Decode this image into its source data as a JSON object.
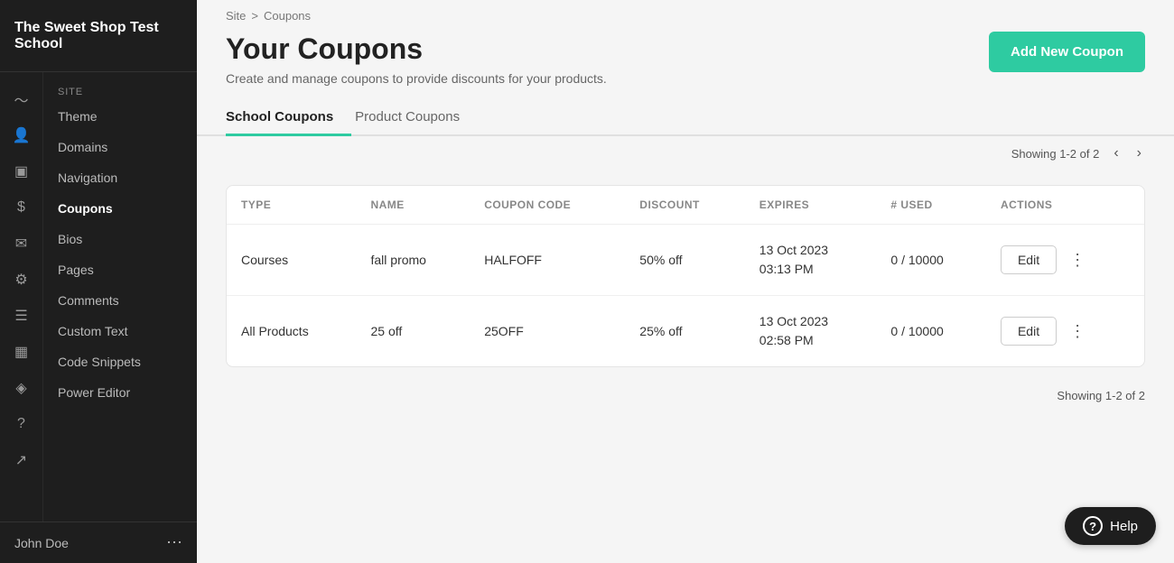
{
  "sidebar": {
    "school_name": "The Sweet Shop Test School",
    "site_section_label": "SITE",
    "nav_items": [
      {
        "id": "theme",
        "label": "Theme",
        "icon": "◨"
      },
      {
        "id": "domains",
        "label": "Domains",
        "icon": "⊕"
      },
      {
        "id": "navigation",
        "label": "Navigation",
        "icon": "☰"
      },
      {
        "id": "coupons",
        "label": "Coupons",
        "icon": "✂",
        "active": true
      },
      {
        "id": "bios",
        "label": "Bios",
        "icon": "⚙"
      },
      {
        "id": "pages",
        "label": "Pages",
        "icon": "☰"
      },
      {
        "id": "comments",
        "label": "Comments",
        "icon": "✉"
      },
      {
        "id": "custom-text",
        "label": "Custom Text",
        "icon": "T"
      },
      {
        "id": "code-snippets",
        "label": "Code Snippets",
        "icon": "</>"
      },
      {
        "id": "power-editor",
        "label": "Power Editor",
        "icon": "⚡"
      }
    ],
    "footer": {
      "user_name": "John Doe"
    }
  },
  "breadcrumb": {
    "site": "Site",
    "separator": ">",
    "current": "Coupons"
  },
  "page": {
    "title": "Your Coupons",
    "subtitle": "Create and manage coupons to provide discounts for your products.",
    "add_button": "Add New Coupon"
  },
  "tabs": [
    {
      "id": "school-coupons",
      "label": "School Coupons",
      "active": true
    },
    {
      "id": "product-coupons",
      "label": "Product Coupons",
      "active": false
    }
  ],
  "pagination": {
    "showing": "Showing 1-2 of 2",
    "showing_bottom": "Showing 1-2 of 2"
  },
  "table": {
    "columns": [
      "TYPE",
      "NAME",
      "COUPON CODE",
      "DISCOUNT",
      "EXPIRES",
      "# USED",
      "ACTIONS"
    ],
    "rows": [
      {
        "type": "Courses",
        "name": "fall promo",
        "coupon_code": "HALFOFF",
        "discount": "50% off",
        "expires_line1": "13 Oct 2023",
        "expires_line2": "03:13 PM",
        "used": "0 / 10000",
        "edit_label": "Edit"
      },
      {
        "type": "All Products",
        "name": "25 off",
        "coupon_code": "25OFF",
        "discount": "25% off",
        "expires_line1": "13 Oct 2023",
        "expires_line2": "02:58 PM",
        "used": "0 / 10000",
        "edit_label": "Edit"
      }
    ]
  },
  "help": {
    "label": "Help"
  },
  "icons": {
    "analytics": "📊",
    "users": "👤",
    "dashboard": "▣",
    "dollar": "💲",
    "mail": "✉",
    "settings": "⚙",
    "pages": "☰",
    "calendar": "📅",
    "badge": "🏷",
    "question": "?",
    "share": "↗"
  }
}
